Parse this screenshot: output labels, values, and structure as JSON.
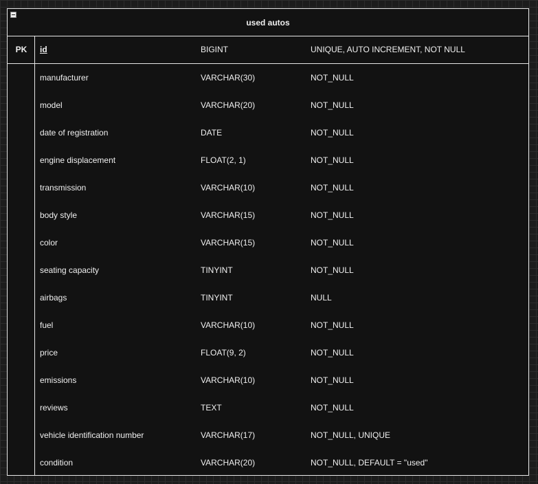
{
  "table": {
    "title": "used autos",
    "pk_label": "PK",
    "primary_key": {
      "name": "id",
      "type": "BIGINT",
      "constraints": "UNIQUE, AUTO INCREMENT, NOT NULL"
    },
    "fields": [
      {
        "name": "manufacturer",
        "type": "VARCHAR(30)",
        "constraints": "NOT_NULL"
      },
      {
        "name": "model",
        "type": "VARCHAR(20)",
        "constraints": "NOT_NULL"
      },
      {
        "name": "date of registration",
        "type": "DATE",
        "constraints": "NOT_NULL"
      },
      {
        "name": "engine displacement",
        "type": "FLOAT(2, 1)",
        "constraints": "NOT_NULL"
      },
      {
        "name": "transmission",
        "type": "VARCHAR(10)",
        "constraints": "NOT_NULL"
      },
      {
        "name": "body style",
        "type": "VARCHAR(15)",
        "constraints": "NOT_NULL"
      },
      {
        "name": "color",
        "type": "VARCHAR(15)",
        "constraints": "NOT_NULL"
      },
      {
        "name": "seating capacity",
        "type": "TINYINT",
        "constraints": "NOT_NULL"
      },
      {
        "name": "airbags",
        "type": "TINYINT",
        "constraints": "NULL"
      },
      {
        "name": "fuel",
        "type": "VARCHAR(10)",
        "constraints": "NOT_NULL"
      },
      {
        "name": "price",
        "type": "FLOAT(9, 2)",
        "constraints": "NOT_NULL"
      },
      {
        "name": "emissions",
        "type": "VARCHAR(10)",
        "constraints": "NOT_NULL"
      },
      {
        "name": "reviews",
        "type": "TEXT",
        "constraints": "NOT_NULL"
      },
      {
        "name": "vehicle identification number",
        "type": "VARCHAR(17)",
        "constraints": "NOT_NULL, UNIQUE"
      },
      {
        "name": "condition",
        "type": "VARCHAR(20)",
        "constraints": "NOT_NULL, DEFAULT = \"used\""
      }
    ]
  },
  "colors": {
    "background": "#1c1c1c",
    "grid": "#2c2c2c",
    "table_fill": "#121212",
    "border": "#e8e8e8",
    "text": "#f0f0f0"
  }
}
